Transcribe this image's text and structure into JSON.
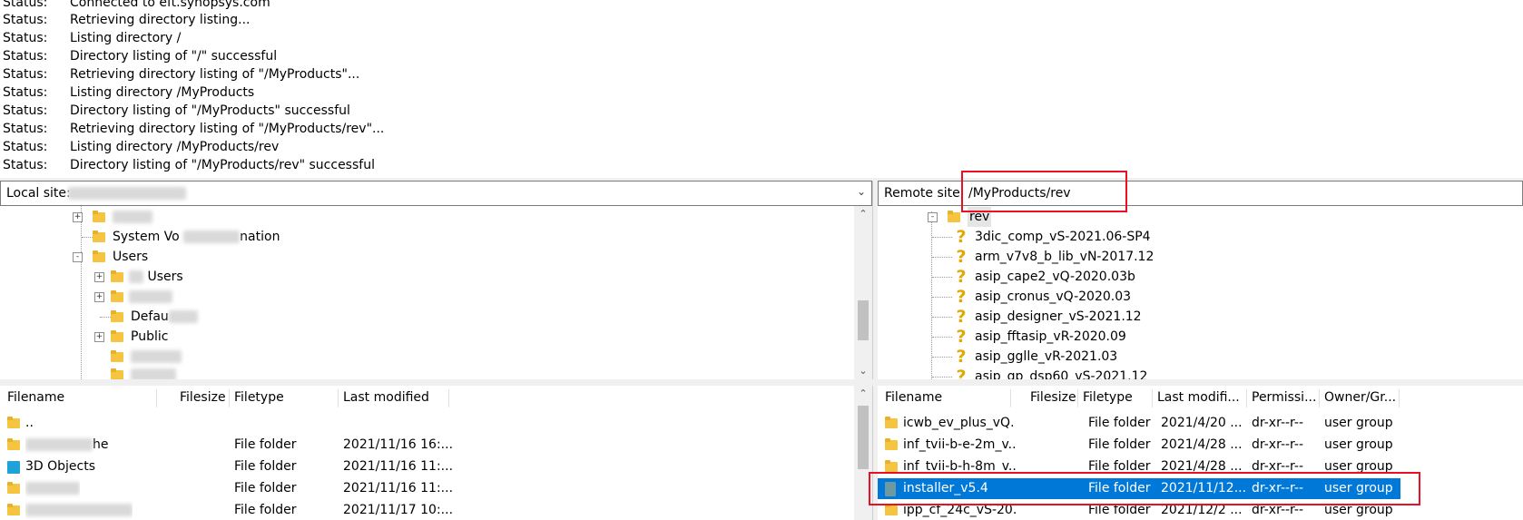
{
  "log": {
    "lines": [
      {
        "label": "Status:",
        "msg": "Connected to eft.synopsys.com"
      },
      {
        "label": "Status:",
        "msg": "Retrieving directory listing..."
      },
      {
        "label": "Status:",
        "msg": "Listing directory /"
      },
      {
        "label": "Status:",
        "msg": "Directory listing of \"/\" successful"
      },
      {
        "label": "Status:",
        "msg": "Retrieving directory listing of \"/MyProducts\"..."
      },
      {
        "label": "Status:",
        "msg": "Listing directory /MyProducts"
      },
      {
        "label": "Status:",
        "msg": "Directory listing of \"/MyProducts\" successful"
      },
      {
        "label": "Status:",
        "msg": "Retrieving directory listing of \"/MyProducts/rev\"..."
      },
      {
        "label": "Status:",
        "msg": "Listing directory /MyProducts/rev"
      },
      {
        "label": "Status:",
        "msg": "Directory listing of \"/MyProducts/rev\" successful"
      }
    ]
  },
  "local": {
    "site_label": "Local site:",
    "tree": [
      {
        "label": "",
        "expander": "+"
      },
      {
        "label": "System Vo",
        "label2": "nation",
        "expander": ""
      },
      {
        "label": "Users",
        "expander": "-"
      },
      {
        "label": "Users",
        "expander": "+"
      },
      {
        "label": "",
        "expander": "+"
      },
      {
        "label": "Defau",
        "expander": ""
      },
      {
        "label": "Public",
        "expander": "+"
      }
    ],
    "columns": {
      "filename": "Filename",
      "filesize": "Filesize",
      "filetype": "Filetype",
      "modified": "Last modified"
    },
    "files": [
      {
        "name": "..",
        "type": "",
        "modified": ""
      },
      {
        "name": "he",
        "type": "File folder",
        "modified": "2021/11/16 16:..."
      },
      {
        "name": "3D Objects",
        "type": "File folder",
        "modified": "2021/11/16 11:..."
      },
      {
        "name": "",
        "type": "File folder",
        "modified": "2021/11/16 11:..."
      },
      {
        "name": "",
        "type": "File folder",
        "modified": "2021/11/17 10:..."
      }
    ]
  },
  "remote": {
    "site_label": "Remote site:",
    "site_path": "/MyProducts/rev",
    "tree_root": "rev",
    "tree": [
      "3dic_comp_vS-2021.06-SP4",
      "arm_v7v8_b_lib_vN-2017.12",
      "asip_cape2_vQ-2020.03b",
      "asip_cronus_vQ-2020.03",
      "asip_designer_vS-2021.12",
      "asip_fftasip_vR-2020.09",
      "asip_gglle_vR-2021.03",
      "asip_gp_dsp60_vS-2021.12"
    ],
    "columns": {
      "filename": "Filename",
      "filesize": "Filesize",
      "filetype": "Filetype",
      "modified": "Last modifi...",
      "perms": "Permissi...",
      "owner": "Owner/Gr..."
    },
    "files": [
      {
        "name": "icwb_ev_plus_vQ...",
        "type": "File folder",
        "modified": "2021/4/20 ...",
        "perms": "dr-xr--r--",
        "owner": "user group",
        "selected": false
      },
      {
        "name": "inf_tvii-b-e-2m_v...",
        "type": "File folder",
        "modified": "2021/4/28 ...",
        "perms": "dr-xr--r--",
        "owner": "user group",
        "selected": false
      },
      {
        "name": "inf_tvii-b-h-8m_v...",
        "type": "File folder",
        "modified": "2021/4/28 ...",
        "perms": "dr-xr--r--",
        "owner": "user group",
        "selected": false
      },
      {
        "name": "installer_v5.4",
        "type": "File folder",
        "modified": "2021/11/12...",
        "perms": "dr-xr--r--",
        "owner": "user group",
        "selected": true
      },
      {
        "name": "ipp_cf_24c_vS-20...",
        "type": "File folder",
        "modified": "2021/12/2 ...",
        "perms": "dr-xr--r--",
        "owner": "user group",
        "selected": false
      }
    ]
  },
  "colors": {
    "selection": "#0078d7",
    "highlight_box": "#e81123",
    "folder": "#f5c542"
  }
}
